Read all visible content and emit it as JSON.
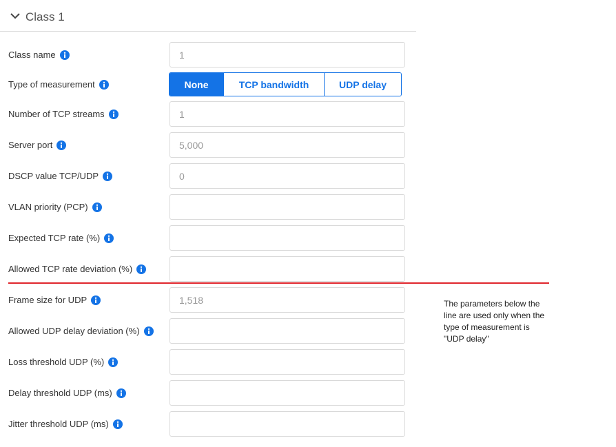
{
  "section": {
    "title": "Class 1",
    "icon": "chevron-down-icon"
  },
  "rows": [
    {
      "label": "Class name",
      "value": "1",
      "placeholder": ""
    },
    {
      "label": "Type of measurement"
    },
    {
      "label": "Number of TCP streams",
      "value": "1",
      "placeholder": ""
    },
    {
      "label": "Server port",
      "value": "5,000",
      "placeholder": ""
    },
    {
      "label": "DSCP value TCP/UDP",
      "value": "0",
      "placeholder": ""
    },
    {
      "label": "VLAN priority (PCP)",
      "value": "",
      "placeholder": ""
    },
    {
      "label": "Expected TCP rate (%)",
      "value": "",
      "placeholder": ""
    },
    {
      "label": "Allowed TCP rate deviation (%)",
      "value": "",
      "placeholder": ""
    },
    {
      "label": "Frame size for UDP",
      "value": "1,518",
      "placeholder": ""
    },
    {
      "label": "Allowed UDP delay deviation (%)",
      "value": "",
      "placeholder": ""
    },
    {
      "label": "Loss threshold UDP (%)",
      "value": "",
      "placeholder": ""
    },
    {
      "label": "Delay threshold UDP (ms)",
      "value": "",
      "placeholder": ""
    },
    {
      "label": "Jitter threshold UDP (ms)",
      "value": "",
      "placeholder": ""
    }
  ],
  "measurement": {
    "options": [
      "None",
      "TCP bandwidth",
      "UDP delay"
    ],
    "selected": "None"
  },
  "note": {
    "line1": "The parameters below the",
    "line2": "line are used only when the",
    "line3": "type of measurement is",
    "line4": "\"UDP delay\""
  },
  "colors": {
    "accent": "#1473e6",
    "divider": "#e0262c",
    "border": "#d9d9d9"
  }
}
